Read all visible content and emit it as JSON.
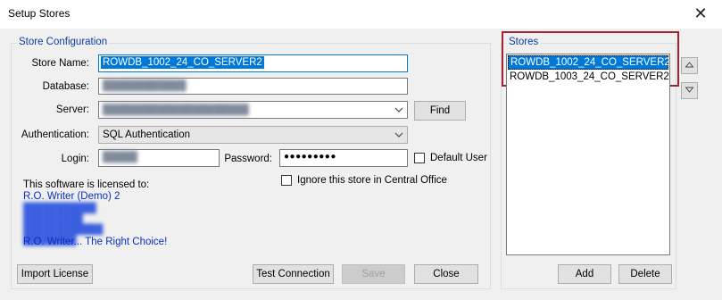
{
  "window": {
    "title": "Setup Stores",
    "close_glyph": "✕"
  },
  "store_config": {
    "legend": "Store Configuration",
    "store_name_label": "Store Name:",
    "store_name_value": "ROWDB_1002_24_CO_SERVER2",
    "database_label": "Database:",
    "server_label": "Server:",
    "find_button": "Find",
    "authentication_label": "Authentication:",
    "authentication_value": "SQL Authentication",
    "login_label": "Login:",
    "password_label": "Password:",
    "password_value": "●●●●●●●●●",
    "default_user_label": "Default User",
    "ignore_label": "Ignore this store in Central Office",
    "license_heading": "This software is licensed to:",
    "license_name": "R.O. Writer (Demo) 2",
    "license_tagline": "R.O. Writer... The Right Choice!",
    "import_license_button": "Import License",
    "test_connection_button": "Test Connection",
    "save_button": "Save",
    "close_button": "Close"
  },
  "stores": {
    "legend": "Stores",
    "items": [
      {
        "label": "ROWDB_1002_24_CO_SERVER2",
        "selected": true
      },
      {
        "label": "ROWDB_1003_24_CO_SERVER2",
        "selected": false
      }
    ],
    "add_button": "Add",
    "delete_button": "Delete"
  },
  "icons": {
    "dropdown": "chevron-down-icon",
    "move_up": "triangle-up-icon",
    "move_down": "triangle-down-icon"
  },
  "colors": {
    "selection": "#0078d7",
    "legend_text": "#0a3ea1",
    "highlight_border": "#a3242c",
    "license_text": "#0a2fbf"
  }
}
